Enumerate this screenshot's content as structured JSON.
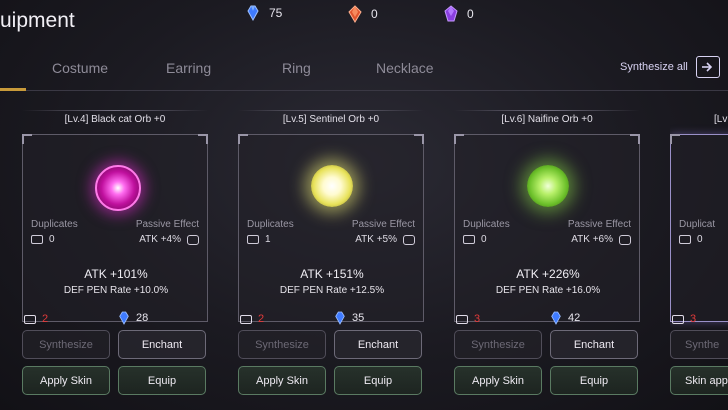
{
  "header": {
    "title": "uipment"
  },
  "currencies": [
    {
      "name": "blue-crystal",
      "value": "75",
      "color": "#3f7bff"
    },
    {
      "name": "red-gem",
      "value": "0",
      "color": "#e0552e"
    },
    {
      "name": "purple-gem",
      "value": "0",
      "color": "#8a3fe0"
    }
  ],
  "tabs": [
    {
      "label": "Costume"
    },
    {
      "label": "Earring"
    },
    {
      "label": "Ring"
    },
    {
      "label": "Necklace"
    }
  ],
  "synthesize_all_label": "Synthesize all",
  "cards": [
    {
      "title": "[Lv.4] Black cat Orb +0",
      "orb_color": "#e42bd2",
      "duplicates_label": "Duplicates",
      "duplicates_value": "0",
      "passive_label": "Passive Effect",
      "passive_value": "ATK +4%",
      "stat_main": "ATK +101%",
      "stat_sub": "DEF PEN Rate +10.0%",
      "owned": "2",
      "cost": "28",
      "btn_synthesize": "Synthesize",
      "btn_enchant": "Enchant",
      "btn_apply_skin": "Apply Skin",
      "btn_equip": "Equip"
    },
    {
      "title": "[Lv.5] Sentinel Orb +0",
      "orb_color": "#f3f07a",
      "duplicates_label": "Duplicates",
      "duplicates_value": "1",
      "passive_label": "Passive Effect",
      "passive_value": "ATK +5%",
      "stat_main": "ATK +151%",
      "stat_sub": "DEF PEN Rate +12.5%",
      "owned": "2",
      "cost": "35",
      "btn_synthesize": "Synthesize",
      "btn_enchant": "Enchant",
      "btn_apply_skin": "Apply Skin",
      "btn_equip": "Equip"
    },
    {
      "title": "[Lv.6] Naifine Orb +0",
      "orb_color": "#8fe04a",
      "duplicates_label": "Duplicates",
      "duplicates_value": "0",
      "passive_label": "Passive Effect",
      "passive_value": "ATK +6%",
      "stat_main": "ATK +226%",
      "stat_sub": "DEF PEN Rate +16.0%",
      "owned": "3",
      "cost": "42",
      "btn_synthesize": "Synthesize",
      "btn_enchant": "Enchant",
      "btn_apply_skin": "Apply Skin",
      "btn_equip": "Equip"
    }
  ],
  "partial_card": {
    "title": "[Lv",
    "duplicates_label": "Duplicat",
    "duplicates_value": "0",
    "owned": "3",
    "btn_synthesize": "Synthe",
    "btn_apply_skin": "Skin app"
  }
}
